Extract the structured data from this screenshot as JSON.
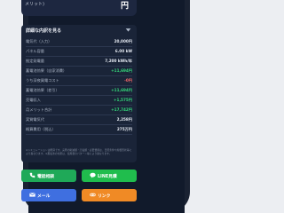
{
  "top": {
    "label": "メリット)",
    "unit": "円"
  },
  "details": {
    "header": "詳細な内訳を見る",
    "rows": [
      {
        "key": "電気代（入力）",
        "value": "20,000円",
        "tone": "normal"
      },
      {
        "key": "パネル容量",
        "value": "6.00 kW",
        "tone": "normal"
      },
      {
        "key": "推定発電量",
        "value": "7,200 kWh/年",
        "tone": "normal"
      },
      {
        "key": "蓄電池効果（自家消費）",
        "value": "+11,694円",
        "tone": "green"
      },
      {
        "key": "うち深夜買電コスト",
        "value": "-0円",
        "tone": "red"
      },
      {
        "key": "蓄電池効果（差引）",
        "value": "+11,694円",
        "tone": "green"
      },
      {
        "key": "売電収入",
        "value": "+1,575円",
        "tone": "green"
      },
      {
        "key": "月メリット合計",
        "value": "+17,742円",
        "tone": "green"
      },
      {
        "key": "実質電気代",
        "value": "2,258円",
        "tone": "normal"
      },
      {
        "key": "概算費用（税込）",
        "value": "275万円",
        "tone": "normal"
      }
    ],
    "note": "※シミュレーションは概算です。実際の削減額・売電額・必要費用は、日照条件や屋根形状等により異なります。※蓄電池の効果は、使用量のパターン等により異なります。"
  },
  "buttons": {
    "phone": "電話相談",
    "line": "LINE見積",
    "mail": "メール",
    "link": "リンク"
  },
  "colors": {
    "accent_green": "#34d77a",
    "negative_red": "#ff6b6b",
    "btn_phone": "#1fa958",
    "btn_line": "#20bd4d",
    "btn_mail": "#3f6fe0",
    "btn_link": "#f08a25"
  },
  "icons": [
    "phone-icon",
    "chat-icon",
    "mail-icon",
    "link-icon",
    "chevron-down-icon"
  ]
}
